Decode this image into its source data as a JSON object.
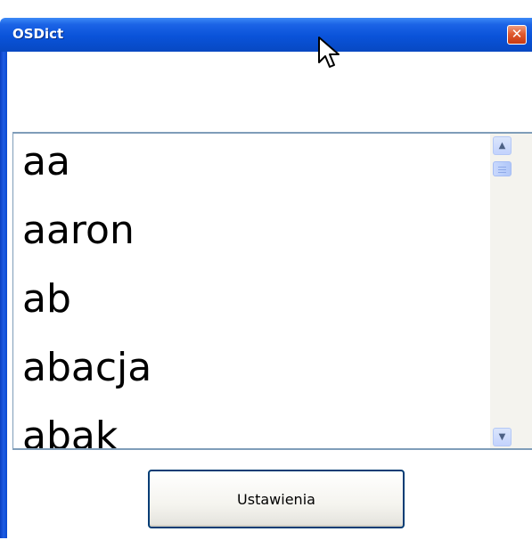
{
  "window": {
    "title": "OSDict",
    "close_symbol": "✕"
  },
  "search": {
    "value": "",
    "placeholder": ""
  },
  "word_list": {
    "items": [
      "aa",
      "aaron",
      "ab",
      "abacja",
      "abak"
    ]
  },
  "scrollbar": {
    "up_arrow": "▲",
    "down_arrow": "▼"
  },
  "settings": {
    "button_label": "Ustawienia"
  },
  "colors": {
    "titlebar_blue": "#0a53d9",
    "close_red": "#df5a30",
    "border": "#7f9db9",
    "button_border": "#003c74"
  },
  "icons": {
    "cursor": "mouse-pointer-icon",
    "close": "close-icon",
    "scroll_up": "scroll-up-arrow-icon",
    "scroll_down": "scroll-down-arrow-icon"
  }
}
